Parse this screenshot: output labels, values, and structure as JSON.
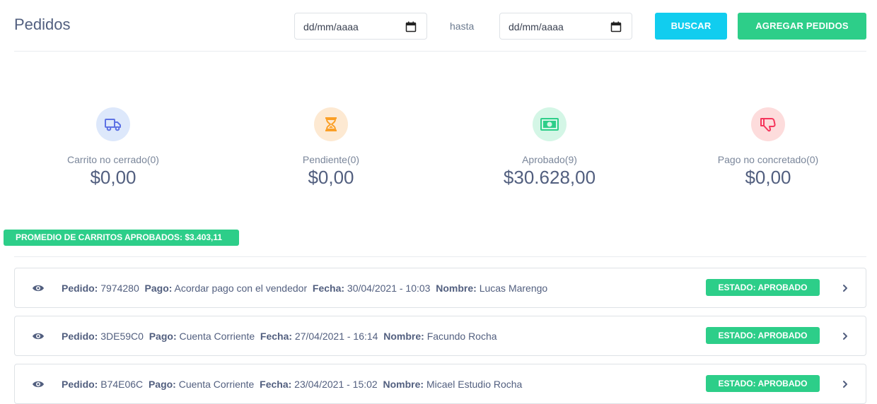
{
  "header": {
    "title": "Pedidos",
    "date_from_placeholder": "dd/mm/aaaa",
    "hasta_label": "hasta",
    "date_to_placeholder": "dd/mm/aaaa",
    "buscar_label": "BUSCAR",
    "agregar_label": "AGREGAR PEDIDOS"
  },
  "stats": [
    {
      "label": "Carrito no cerrado(0)",
      "value": "$0,00",
      "icon": "truck-icon",
      "bg": "#dde8fb",
      "fg": "#5e72e4"
    },
    {
      "label": "Pendiente(0)",
      "value": "$0,00",
      "icon": "hourglass-icon",
      "bg": "#fde9d2",
      "fg": "#fb9f26"
    },
    {
      "label": "Aprobado(9)",
      "value": "$30.628,00",
      "icon": "money-icon",
      "bg": "#d4f6e6",
      "fg": "#2dce89"
    },
    {
      "label": "Pago no concretado(0)",
      "value": "$0,00",
      "icon": "thumbs-down-icon",
      "bg": "#fddcdc",
      "fg": "#f5365c"
    }
  ],
  "promedio_badge": "PROMEDIO DE CARRITOS APROBADOS: $3.403,11",
  "orders_labels": {
    "pedido": "Pedido:",
    "pago": "Pago:",
    "fecha": "Fecha:",
    "nombre": "Nombre:"
  },
  "orders": [
    {
      "pedido": "7974280",
      "pago": "Acordar pago con el vendedor",
      "fecha": "30/04/2021 - 10:03",
      "nombre": "Lucas Marengo",
      "estado": "ESTADO: APROBADO"
    },
    {
      "pedido": "3DE59C0",
      "pago": "Cuenta Corriente",
      "fecha": "27/04/2021 - 16:14",
      "nombre": "Facundo Rocha",
      "estado": "ESTADO: APROBADO"
    },
    {
      "pedido": "B74E06C",
      "pago": "Cuenta Corriente",
      "fecha": "23/04/2021 - 15:02",
      "nombre": "Micael Estudio Rocha",
      "estado": "ESTADO: APROBADO"
    }
  ],
  "colors": {
    "accent_cyan": "#11cdef",
    "accent_green": "#2dce89"
  }
}
